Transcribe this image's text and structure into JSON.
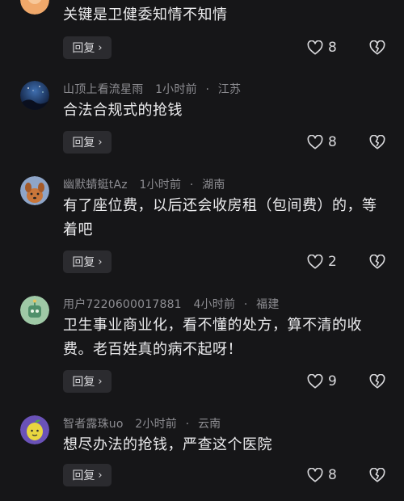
{
  "comments": [
    {
      "username": "",
      "time": "",
      "location": "",
      "text": "关键是卫健委知情不知情",
      "reply_label": "回复",
      "likes": "8",
      "avatar_icon": "orange-circle-avatar-icon"
    },
    {
      "username": "山顶上看流星雨",
      "time": "1小时前",
      "location": "江苏",
      "text": "合法合规式的抢钱",
      "reply_label": "回复",
      "likes": "8",
      "avatar_icon": "night-sky-avatar-icon"
    },
    {
      "username": "幽默蜻蜓tAz",
      "time": "1小时前",
      "location": "湖南",
      "text": "有了座位费，以后还会收房租（包间费）的，等着吧",
      "reply_label": "回复",
      "likes": "2",
      "avatar_icon": "cartoon-dog-avatar-icon"
    },
    {
      "username": "用户7220600017881",
      "time": "4小时前",
      "location": "福建",
      "text": "卫生事业商业化，看不懂的处方，算不清的收费。老百姓真的病不起呀！",
      "reply_label": "回复",
      "likes": "9",
      "avatar_icon": "green-robot-avatar-icon"
    },
    {
      "username": "智者露珠uo",
      "time": "2小时前",
      "location": "云南",
      "text": "想尽办法的抢钱，严查这个医院",
      "reply_label": "回复",
      "likes": "8",
      "avatar_icon": "lemon-avatar-icon"
    }
  ],
  "separator": "·",
  "colors": {
    "background": "#161618",
    "meta": "#8d8d92",
    "text": "#ececee",
    "reply_bg": "#2b2b2f"
  }
}
